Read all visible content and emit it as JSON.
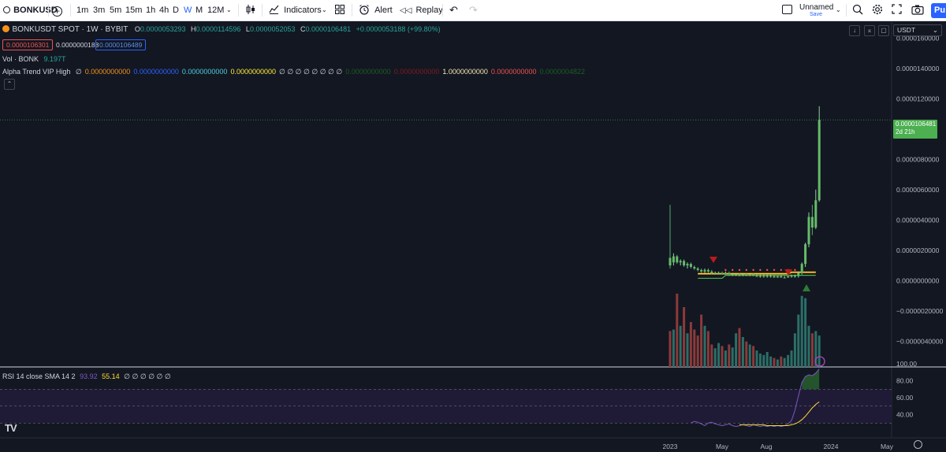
{
  "toolbar": {
    "symbol": "BONKUSD",
    "intervals": [
      "1m",
      "3m",
      "5m",
      "15m",
      "1h",
      "4h",
      "D",
      "W",
      "M",
      "12M"
    ],
    "active_interval": "W",
    "indicators_label": "Indicators",
    "alert_label": "Alert",
    "replay_label": "Replay",
    "layout_name": "Unnamed",
    "layout_status": "Save",
    "publish_label": "Pu"
  },
  "legend": {
    "title": "BONKUSDT SPOT · 1W · BYBIT",
    "o_label": "O",
    "o_value": "0.0000053293",
    "h_label": "H",
    "h_value": "0.0000114596",
    "l_label": "L",
    "l_value": "0.0000052053",
    "c_label": "C",
    "c_value": "0.0000106481",
    "change": "+0.0000053188 (+99.80%)",
    "sell_price": "0.0000106301",
    "spread": "0.0000000188",
    "buy_price": "0.0000106489",
    "vol_label": "Vol · BONK",
    "vol_value": "9.197T",
    "alpha_label": "Alpha Trend VIP High",
    "alpha_values": [
      {
        "text": "∅",
        "color": "#d1d4dc"
      },
      {
        "text": "0.0000000000",
        "color": "#f7931a"
      },
      {
        "text": "0.0000000000",
        "color": "#2962ff"
      },
      {
        "text": "0.0000000000",
        "color": "#4dd0e1"
      },
      {
        "text": "0.0000000000",
        "color": "#ffeb3b"
      },
      {
        "text": "∅ ∅ ∅ ∅ ∅ ∅ ∅ ∅",
        "color": "#d1d4dc"
      },
      {
        "text": "0.0000000000",
        "color": "#1b5e20"
      },
      {
        "text": "0.0000000000",
        "color": "#7f1d1d"
      },
      {
        "text": "1.0000000000",
        "color": "#f3e5ab"
      },
      {
        "text": "0.0000000000",
        "color": "#ef5350"
      },
      {
        "text": "0.0000004822",
        "color": "#1b5e20"
      }
    ],
    "rsi_label": "RSI 14 close SMA 14 2",
    "rsi_value": "93.92",
    "rsi_sma_value": "55.14",
    "rsi_tail": "∅ ∅ ∅ ∅ ∅ ∅"
  },
  "currency": "USDT",
  "price_axis": [
    "0.0000160000",
    "0.0000140000",
    "0.0000120000",
    "0.0000080000",
    "0.0000060000",
    "0.0000040000",
    "0.0000020000",
    "0.0000000000",
    "−0.0000020000",
    "−0.0000040000"
  ],
  "last_price": {
    "value": "0.0000106481",
    "countdown": "2d 21h"
  },
  "rsi_axis": [
    "100.00",
    "80.00",
    "60.00",
    "40.00"
  ],
  "time_axis": [
    "2023",
    "May",
    "Aug",
    "2024",
    "May"
  ],
  "logo_text": "TV",
  "colors": {
    "up": "#26a69a",
    "down": "#ef5350",
    "bg": "#131722",
    "grid": "#2a2e39",
    "accent": "#2962ff",
    "last_price_bg": "#4caf50"
  },
  "chart_data": {
    "type": "candlestick",
    "interval": "1W",
    "ylim": [
      -4.5e-06,
      1.7e-05
    ],
    "candles": [
      {
        "o": 1.5e-06,
        "h": 5e-06,
        "l": 8e-07,
        "c": 1e-06
      },
      {
        "o": 1.2e-06,
        "h": 1.8e-06,
        "l": 1e-06,
        "c": 1.6e-06
      },
      {
        "o": 1.6e-06,
        "h": 1.7e-06,
        "l": 1.1e-06,
        "c": 1.2e-06
      },
      {
        "o": 1.2e-06,
        "h": 1.4e-06,
        "l": 1e-06,
        "c": 1.3e-06
      },
      {
        "o": 1.3e-06,
        "h": 1.4e-06,
        "l": 9e-07,
        "c": 1e-06
      },
      {
        "o": 1e-06,
        "h": 1.2e-06,
        "l": 8e-07,
        "c": 1.1e-06
      },
      {
        "o": 1.1e-06,
        "h": 1.2e-06,
        "l": 8e-07,
        "c": 9e-07
      },
      {
        "o": 9e-07,
        "h": 1e-06,
        "l": 7e-07,
        "c": 8e-07
      },
      {
        "o": 8e-07,
        "h": 9e-07,
        "l": 6e-07,
        "c": 7e-07
      },
      {
        "o": 7e-07,
        "h": 8e-07,
        "l": 5e-07,
        "c": 6e-07
      },
      {
        "o": 6e-07,
        "h": 8e-07,
        "l": 5e-07,
        "c": 7e-07
      },
      {
        "o": 7e-07,
        "h": 8e-07,
        "l": 5e-07,
        "c": 6e-07
      },
      {
        "o": 6e-07,
        "h": 7e-07,
        "l": 4e-07,
        "c": 5e-07
      },
      {
        "o": 5e-07,
        "h": 6e-07,
        "l": 4e-07,
        "c": 5e-07
      },
      {
        "o": 5e-07,
        "h": 6e-07,
        "l": 4e-07,
        "c": 5e-07
      },
      {
        "o": 5e-07,
        "h": 6e-07,
        "l": 4e-07,
        "c": 4e-07
      },
      {
        "o": 4e-07,
        "h": 6e-07,
        "l": 4e-07,
        "c": 5e-07
      },
      {
        "o": 5e-07,
        "h": 6e-07,
        "l": 3e-07,
        "c": 4e-07
      },
      {
        "o": 4e-07,
        "h": 5e-07,
        "l": 3e-07,
        "c": 4e-07
      },
      {
        "o": 4e-07,
        "h": 5e-07,
        "l": 3e-07,
        "c": 4e-07
      },
      {
        "o": 4e-07,
        "h": 5e-07,
        "l": 3e-07,
        "c": 3e-07
      },
      {
        "o": 3e-07,
        "h": 5e-07,
        "l": 3e-07,
        "c": 4e-07
      },
      {
        "o": 4e-07,
        "h": 5e-07,
        "l": 3e-07,
        "c": 3e-07
      },
      {
        "o": 3e-07,
        "h": 4e-07,
        "l": 3e-07,
        "c": 4e-07
      },
      {
        "o": 4e-07,
        "h": 5e-07,
        "l": 3e-07,
        "c": 3e-07
      },
      {
        "o": 3e-07,
        "h": 4e-07,
        "l": 3e-07,
        "c": 3e-07
      },
      {
        "o": 3e-07,
        "h": 4e-07,
        "l": 2e-07,
        "c": 3e-07
      },
      {
        "o": 3e-07,
        "h": 4e-07,
        "l": 2e-07,
        "c": 3e-07
      },
      {
        "o": 3e-07,
        "h": 4e-07,
        "l": 2e-07,
        "c": 3e-07
      },
      {
        "o": 3e-07,
        "h": 4e-07,
        "l": 2e-07,
        "c": 3e-07
      },
      {
        "o": 3e-07,
        "h": 4e-07,
        "l": 2e-07,
        "c": 2e-07
      },
      {
        "o": 2e-07,
        "h": 3e-07,
        "l": 2e-07,
        "c": 3e-07
      },
      {
        "o": 3e-07,
        "h": 4e-07,
        "l": 2e-07,
        "c": 2e-07
      },
      {
        "o": 2e-07,
        "h": 3e-07,
        "l": 2e-07,
        "c": 2e-07
      },
      {
        "o": 2e-07,
        "h": 3e-07,
        "l": 2e-07,
        "c": 3e-07
      },
      {
        "o": 3e-07,
        "h": 4e-07,
        "l": 2e-07,
        "c": 3e-07
      },
      {
        "o": 3e-07,
        "h": 4e-07,
        "l": 2e-07,
        "c": 3e-07
      },
      {
        "o": 3e-07,
        "h": 6e-07,
        "l": 2e-07,
        "c": 5e-07
      },
      {
        "o": 5e-07,
        "h": 1.2e-06,
        "l": 4e-07,
        "c": 1.1e-06
      },
      {
        "o": 1.1e-06,
        "h": 2.5e-06,
        "l": 9e-07,
        "c": 2.4e-06
      },
      {
        "o": 2.4e-06,
        "h": 4.5e-06,
        "l": 2.2e-06,
        "c": 4.2e-06
      },
      {
        "o": 4.2e-06,
        "h": 5e-06,
        "l": 3e-06,
        "c": 3.5e-06
      },
      {
        "o": 3.5e-06,
        "h": 6e-06,
        "l": 3.4e-06,
        "c": 5.3e-06
      },
      {
        "o": 5.3e-06,
        "h": 1.15e-05,
        "l": 5.2e-06,
        "c": 1.06e-05
      }
    ],
    "volume_fraction": [
      0.48,
      0.5,
      0.98,
      0.55,
      0.8,
      0.45,
      0.6,
      0.5,
      0.42,
      0.7,
      0.55,
      0.48,
      0.3,
      0.25,
      0.32,
      0.28,
      0.22,
      0.3,
      0.26,
      0.45,
      0.52,
      0.4,
      0.34,
      0.3,
      0.28,
      0.22,
      0.18,
      0.16,
      0.2,
      0.14,
      0.12,
      0.1,
      0.14,
      0.12,
      0.16,
      0.22,
      0.45,
      0.7,
      0.95,
      0.92,
      0.55,
      0.45,
      0.48,
      0.42
    ],
    "rsi": [
      null,
      null,
      null,
      null,
      null,
      null,
      30,
      32,
      31,
      29,
      27,
      30,
      31,
      29,
      28,
      27,
      28,
      29,
      27,
      26,
      27,
      28,
      27,
      26,
      28,
      27,
      26,
      27,
      26,
      27,
      26,
      27,
      26,
      27,
      29,
      33,
      45,
      62,
      78,
      85,
      87,
      86,
      89,
      93.92
    ],
    "rsi_sma": [
      null,
      null,
      null,
      null,
      null,
      null,
      null,
      null,
      null,
      null,
      null,
      null,
      null,
      null,
      null,
      null,
      null,
      null,
      null,
      null,
      28,
      28,
      28,
      28,
      28,
      28,
      28,
      28,
      27,
      27,
      27,
      27,
      27,
      27,
      27,
      28,
      29,
      31,
      34,
      38,
      43,
      48,
      52,
      55.14
    ]
  }
}
